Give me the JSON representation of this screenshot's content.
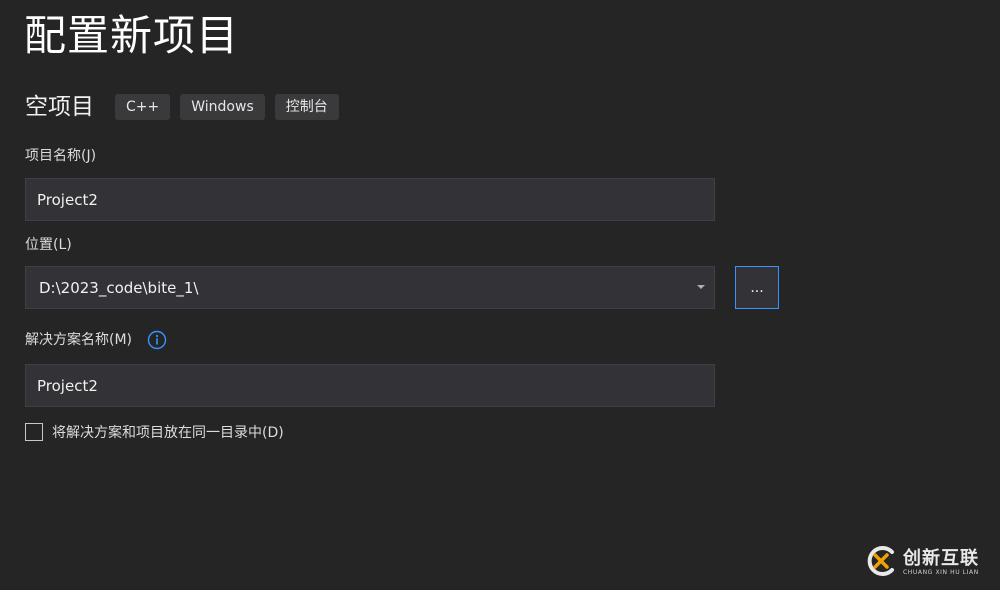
{
  "header": {
    "title": "配置新项目"
  },
  "template": {
    "name": "空项目",
    "tags": [
      "C++",
      "Windows",
      "控制台"
    ]
  },
  "form": {
    "project_name_label": "项目名称(J)",
    "project_name_value": "Project2",
    "location_label": "位置(L)",
    "location_value": "D:\\2023_code\\bite_1\\",
    "browse_label": "...",
    "solution_name_label": "解决方案名称(M)",
    "solution_name_value": "Project2",
    "same_dir_label": "将解决方案和项目放在同一目录中(D)",
    "same_dir_checked": false
  },
  "watermark": {
    "text": "创新互联",
    "subtext": "CHUANG XIN HU LIAN"
  },
  "colors": {
    "background": "#252526",
    "input_background": "#333337",
    "focus_border": "#3794ff",
    "info_icon": "#3794ff",
    "watermark_accent": "#f0a000"
  },
  "icons": {
    "dropdown": "chevron-down-icon",
    "info": "info-icon",
    "logo": "watermark-logo-icon"
  }
}
